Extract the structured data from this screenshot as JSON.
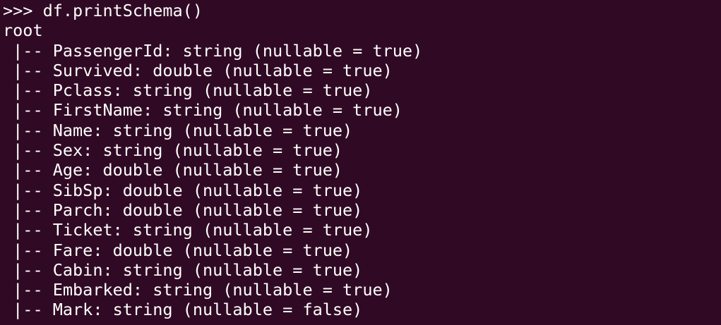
{
  "terminal": {
    "prompt": ">>> ",
    "command": "df.printSchema()",
    "root_label": "root",
    "schema_lines": [
      " |-- PassengerId: string (nullable = true)",
      " |-- Survived: double (nullable = true)",
      " |-- Pclass: string (nullable = true)",
      " |-- FirstName: string (nullable = true)",
      " |-- Name: string (nullable = true)",
      " |-- Sex: string (nullable = true)",
      " |-- Age: double (nullable = true)",
      " |-- SibSp: double (nullable = true)",
      " |-- Parch: double (nullable = true)",
      " |-- Ticket: string (nullable = true)",
      " |-- Fare: double (nullable = true)",
      " |-- Cabin: string (nullable = true)",
      " |-- Embarked: string (nullable = true)",
      " |-- Mark: string (nullable = false)"
    ]
  },
  "colors": {
    "background": "#300a24",
    "text": "#ffffff"
  }
}
